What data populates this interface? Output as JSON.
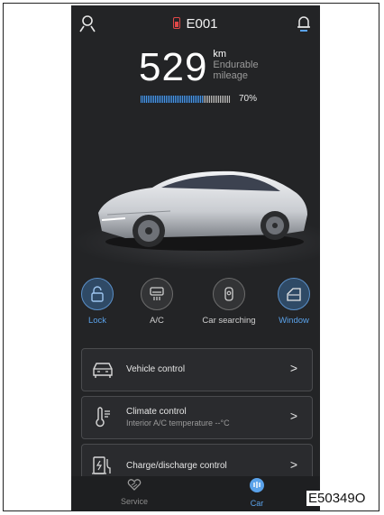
{
  "header": {
    "plate": "E001",
    "left_icon": "user-profile-icon",
    "right_icon": "notification-bell-icon"
  },
  "mileage": {
    "value": "529",
    "unit": "km",
    "label": "Endurable mileage",
    "battery_percent_label": "70%",
    "battery_level": 0.7
  },
  "actions": [
    {
      "label": "Lock",
      "icon": "lock-icon",
      "active": true
    },
    {
      "label": "A/C",
      "icon": "ac-icon",
      "active": false
    },
    {
      "label": "Car searching",
      "icon": "car-key-icon",
      "active": false
    },
    {
      "label": "Window",
      "icon": "window-icon",
      "active": true
    }
  ],
  "cards": [
    {
      "title": "Vehicle control",
      "subtitle": "",
      "icon": "vehicle-icon"
    },
    {
      "title": "Climate control",
      "subtitle": "Interior A/C temperature --°C",
      "icon": "thermometer-icon"
    },
    {
      "title": "Charge/discharge control",
      "subtitle": "",
      "icon": "charger-icon"
    }
  ],
  "nav": {
    "service_label": "Service",
    "car_label": "Car"
  },
  "figure_code": "E50349O",
  "colors": {
    "background": "#232426",
    "accent": "#5aa2ea",
    "battery_red": "#e04848"
  }
}
